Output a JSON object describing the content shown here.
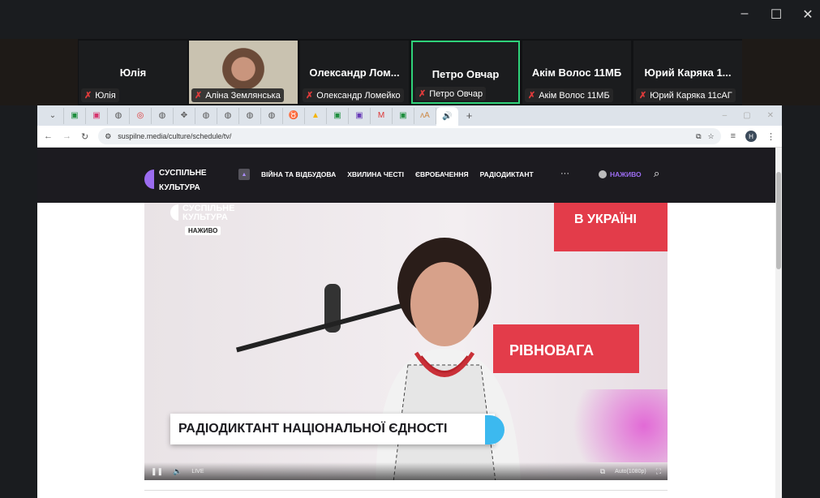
{
  "window": {
    "minimize": "–",
    "maximize": "☐",
    "close": "✕"
  },
  "participants": [
    {
      "name": "Юлія",
      "label": "Юлія",
      "video": false,
      "active": false
    },
    {
      "name": "",
      "label": "Аліна Землянська",
      "video": true,
      "active": false
    },
    {
      "name": "Олександр  Лом...",
      "label": "Олександр Ломейко",
      "video": false,
      "active": false
    },
    {
      "name": "Петро Овчар",
      "label": "Петро Овчар",
      "video": false,
      "active": true
    },
    {
      "name": "Акім Волос 11МБ",
      "label": "Акім Волос 11МБ",
      "video": false,
      "active": false
    },
    {
      "name": "Юрий  Каряка  1...",
      "label": "Юрий Каряка 11сАГ",
      "video": false,
      "active": false
    }
  ],
  "browser": {
    "url": "suspilne.media/culture/schedule/tv/",
    "profile_initial": "Н",
    "new_tab": "+"
  },
  "site": {
    "logo_line1": "СУСПІЛЬНЕ",
    "logo_line2": "КУЛЬТУРА",
    "nav": [
      "ВІЙНА ТА ВІДБУДОВА",
      "ХВИЛИНА ЧЕСТІ",
      "ЄВРОБАЧЕННЯ",
      "РАДІОДИКТАНТ"
    ],
    "more": "···",
    "live": "НАЖИВО"
  },
  "video": {
    "watermark1": "СУСПІЛЬНЕ",
    "watermark2": "КУЛЬТУРА",
    "live_badge": "НАЖИВО",
    "backdrop1": "В УКРАЇНІ",
    "backdrop2": "РІВНОВАГА",
    "lower_third": "РАДІОДИКТАНТ НАЦІОНАЛЬНОЇ ЄДНОСТІ",
    "live_label": "LIVE",
    "quality": "Auto(1080p)"
  }
}
